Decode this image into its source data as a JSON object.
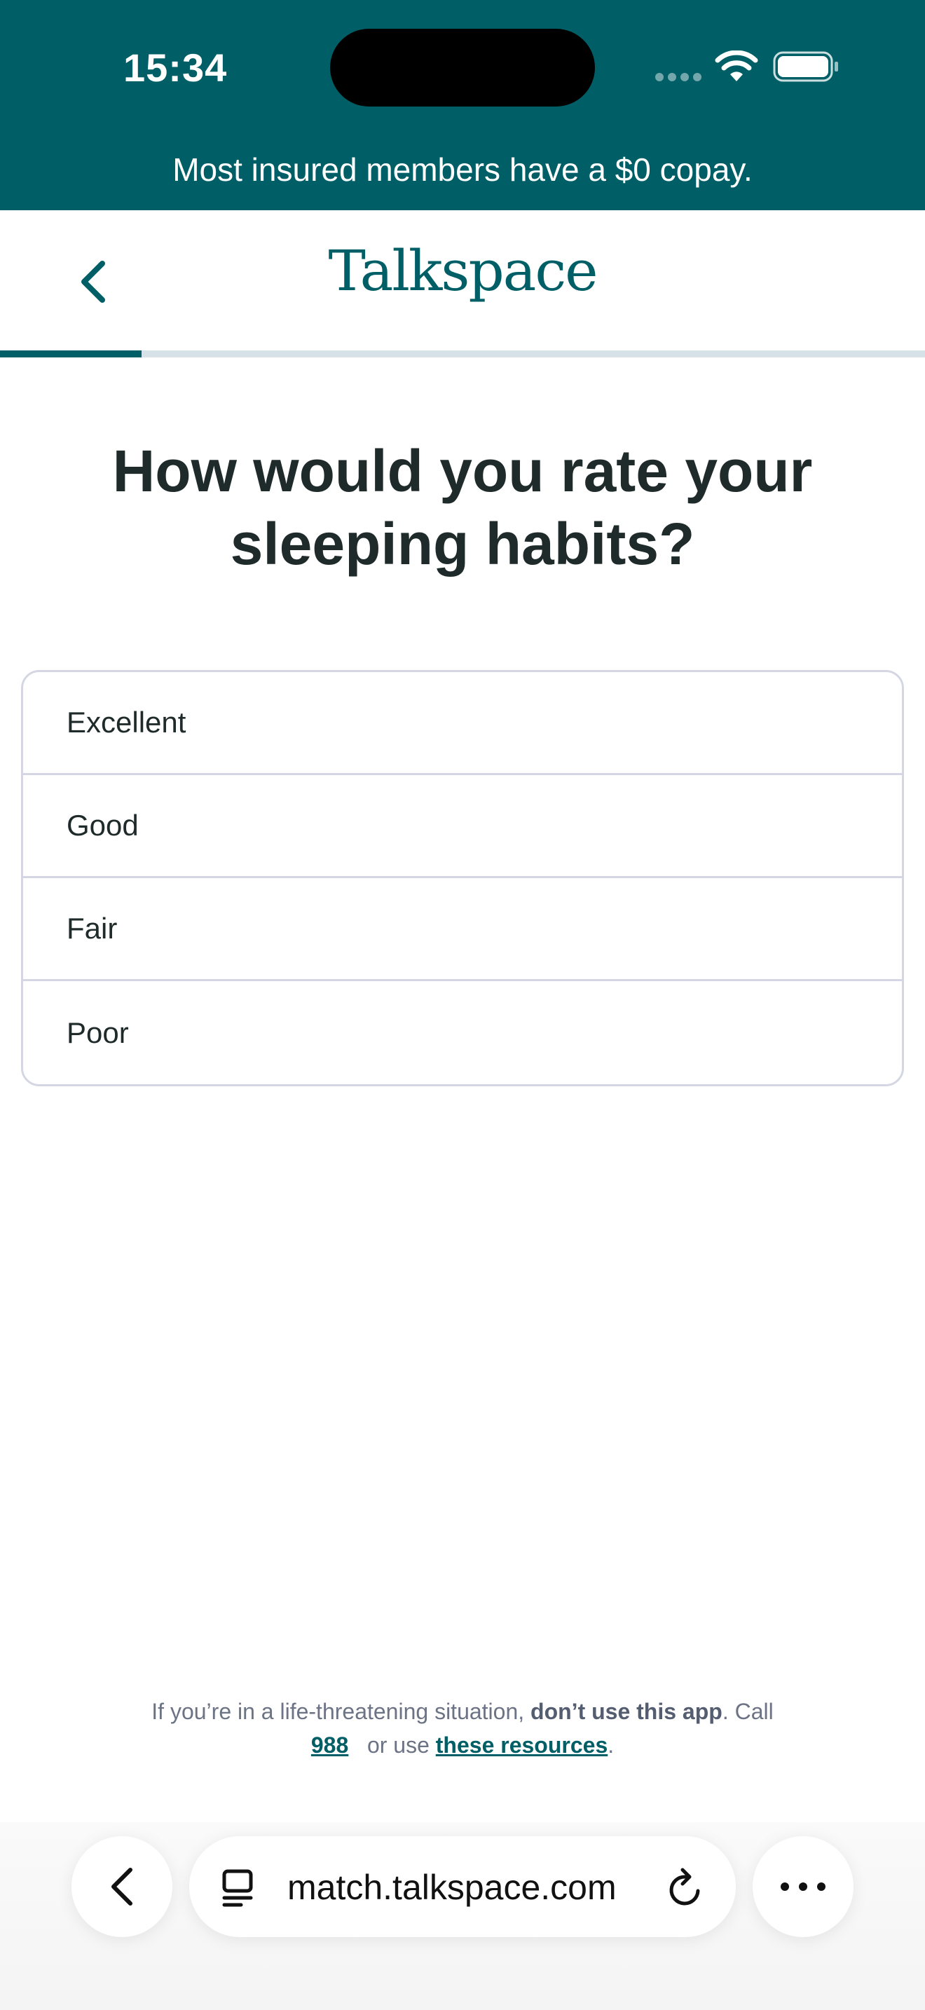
{
  "status_bar": {
    "time": "15:34"
  },
  "promo_banner": {
    "text": "Most insured members have a $0 copay."
  },
  "header": {
    "logo_text": "Talkspace",
    "progress_fraction": 0.153
  },
  "question": {
    "title": "How would you rate your sleeping habits?"
  },
  "options": [
    {
      "label": "Excellent"
    },
    {
      "label": "Good"
    },
    {
      "label": "Fair"
    },
    {
      "label": "Poor"
    }
  ],
  "disclaimer": {
    "prefix": "If you’re in a life-threatening situation,",
    "bold": "don’t use this app",
    "middle": ". Call",
    "phone_link": "988",
    "or_use": "or use",
    "resources_link": "these resources",
    "suffix": "."
  },
  "browser": {
    "url": "match.talkspace.com"
  },
  "colors": {
    "brand": "#005f66",
    "border": "#d4d7e3",
    "progress_track": "#d6e2e8"
  }
}
